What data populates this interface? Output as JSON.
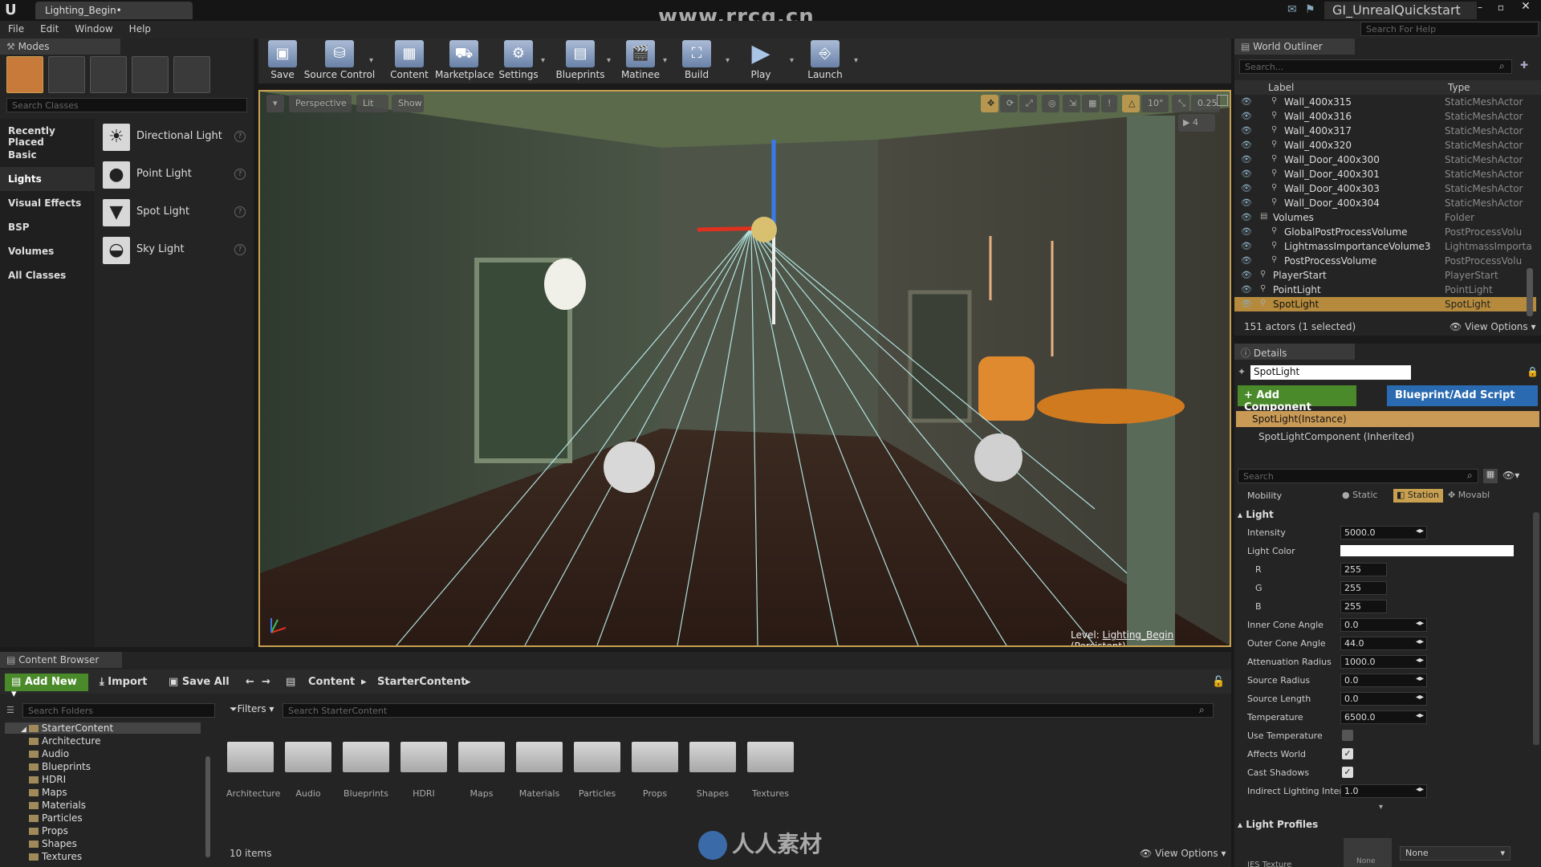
{
  "titlebar": {
    "doc_tab": "Lighting_Begin•",
    "watermark": "www.rrcg.cn",
    "project": "GI_UnrealQuickstart",
    "help_search_placeholder": "Search For Help"
  },
  "menu": [
    "File",
    "Edit",
    "Window",
    "Help"
  ],
  "modes": {
    "title": "Modes",
    "search_placeholder": "Search Classes",
    "categories": [
      "Recently Placed",
      "Basic",
      "Lights",
      "Visual Effects",
      "BSP",
      "Volumes",
      "All Classes"
    ],
    "selected_category": "Lights",
    "items": [
      {
        "label": "Directional Light",
        "icon": "directional-light-icon"
      },
      {
        "label": "Point Light",
        "icon": "point-light-icon"
      },
      {
        "label": "Spot Light",
        "icon": "spot-light-icon"
      },
      {
        "label": "Sky Light",
        "icon": "sky-light-icon"
      }
    ]
  },
  "toolbar": {
    "buttons": [
      {
        "label": "Save",
        "icon": "save-icon"
      },
      {
        "label": "Source Control",
        "icon": "source-control-icon"
      },
      {
        "label": "Content",
        "icon": "content-icon"
      },
      {
        "label": "Marketplace",
        "icon": "marketplace-icon"
      },
      {
        "label": "Settings",
        "icon": "settings-icon"
      },
      {
        "label": "Blueprints",
        "icon": "blueprints-icon"
      },
      {
        "label": "Matinee",
        "icon": "matinee-icon"
      },
      {
        "label": "Build",
        "icon": "build-icon"
      },
      {
        "label": "Play",
        "icon": "play-icon"
      },
      {
        "label": "Launch",
        "icon": "launch-icon"
      }
    ]
  },
  "viewport": {
    "perspective": "Perspective",
    "lit": "Lit",
    "show": "Show",
    "rotation_snap": "10°",
    "scale_snap": "0.25",
    "camera_speed": "4",
    "level_label": "Level:",
    "level_name": "Lighting_Begin (Persistent)"
  },
  "outliner": {
    "title": "World Outliner",
    "search_placeholder": "Search...",
    "col_label": "Label",
    "col_type": "Type",
    "rows": [
      {
        "name": "Wall_400x315",
        "type": "StaticMeshActor",
        "indent": 2
      },
      {
        "name": "Wall_400x316",
        "type": "StaticMeshActor",
        "indent": 2
      },
      {
        "name": "Wall_400x317",
        "type": "StaticMeshActor",
        "indent": 2
      },
      {
        "name": "Wall_400x320",
        "type": "StaticMeshActor",
        "indent": 2
      },
      {
        "name": "Wall_Door_400x300",
        "type": "StaticMeshActor",
        "indent": 2
      },
      {
        "name": "Wall_Door_400x301",
        "type": "StaticMeshActor",
        "indent": 2
      },
      {
        "name": "Wall_Door_400x303",
        "type": "StaticMeshActor",
        "indent": 2
      },
      {
        "name": "Wall_Door_400x304",
        "type": "StaticMeshActor",
        "indent": 2
      },
      {
        "name": "Volumes",
        "type": "Folder",
        "indent": 1
      },
      {
        "name": "GlobalPostProcessVolume",
        "type": "PostProcessVolu",
        "indent": 2
      },
      {
        "name": "LightmassImportanceVolume3",
        "type": "LightmassImporta",
        "indent": 2
      },
      {
        "name": "PostProcessVolume",
        "type": "PostProcessVolu",
        "indent": 2
      },
      {
        "name": "PlayerStart",
        "type": "PlayerStart",
        "indent": 1
      },
      {
        "name": "PointLight",
        "type": "PointLight",
        "indent": 1
      },
      {
        "name": "SpotLight",
        "type": "SpotLight",
        "indent": 1
      }
    ],
    "selected_row": "SpotLight",
    "footer": "151 actors (1 selected)",
    "view_options": "View Options"
  },
  "details": {
    "title": "Details",
    "name": "SpotLight",
    "add_component": "+ Add Component",
    "blueprint_script": "Blueprint/Add Script",
    "component_selected": "SpotLight(Instance)",
    "component_inherited": "SpotLightComponent (Inherited)",
    "search_placeholder": "Search",
    "mobility_label": "Mobility",
    "mobility_options": [
      "Static",
      "Station",
      "Movabl"
    ],
    "mobility_selected": "Station",
    "light_section": "Light",
    "profiles_section": "Light Profiles",
    "props": [
      {
        "label": "Intensity",
        "value": "5000.0",
        "kind": "field"
      },
      {
        "label": "Light Color",
        "value": "",
        "kind": "color"
      },
      {
        "label": "R",
        "value": "255",
        "kind": "short"
      },
      {
        "label": "G",
        "value": "255",
        "kind": "short"
      },
      {
        "label": "B",
        "value": "255",
        "kind": "short"
      },
      {
        "label": "Inner Cone Angle",
        "value": "0.0",
        "kind": "field"
      },
      {
        "label": "Outer Cone Angle",
        "value": "44.0",
        "kind": "field"
      },
      {
        "label": "Attenuation Radius",
        "value": "1000.0",
        "kind": "field"
      },
      {
        "label": "Source Radius",
        "value": "0.0",
        "kind": "field"
      },
      {
        "label": "Source Length",
        "value": "0.0",
        "kind": "field"
      },
      {
        "label": "Temperature",
        "value": "6500.0",
        "kind": "field"
      },
      {
        "label": "Use Temperature",
        "value": "",
        "kind": "check-off"
      },
      {
        "label": "Affects World",
        "value": "",
        "kind": "check-on"
      },
      {
        "label": "Cast Shadows",
        "value": "",
        "kind": "check-on"
      },
      {
        "label": "Indirect Lighting Inten",
        "value": "1.0",
        "kind": "field"
      }
    ],
    "ies_label": "IES Texture",
    "ies_thumb": "None",
    "ies_value": "None"
  },
  "content_browser": {
    "title": "Content Browser",
    "add_new": "Add New",
    "import": "Import",
    "save_all": "Save All",
    "path": [
      "Content",
      "StarterContent"
    ],
    "folder_search_placeholder": "Search Folders",
    "filters": "Filters",
    "asset_search_placeholder": "Search StarterContent",
    "tree_root": "StarterContent",
    "tree": [
      "Architecture",
      "Audio",
      "Blueprints",
      "HDRI",
      "Maps",
      "Materials",
      "Particles",
      "Props",
      "Shapes",
      "Textures"
    ],
    "folders": [
      "Architecture",
      "Audio",
      "Blueprints",
      "HDRI",
      "Maps",
      "Materials",
      "Particles",
      "Props",
      "Shapes",
      "Textures"
    ],
    "item_count": "10 items",
    "view_options": "View Options",
    "footer_watermark": "人人素材"
  },
  "colors": {
    "accent": "#c8a050",
    "green": "#4a8a2a",
    "blue": "#2a6ab0",
    "selected_row": "#b58a3c"
  }
}
